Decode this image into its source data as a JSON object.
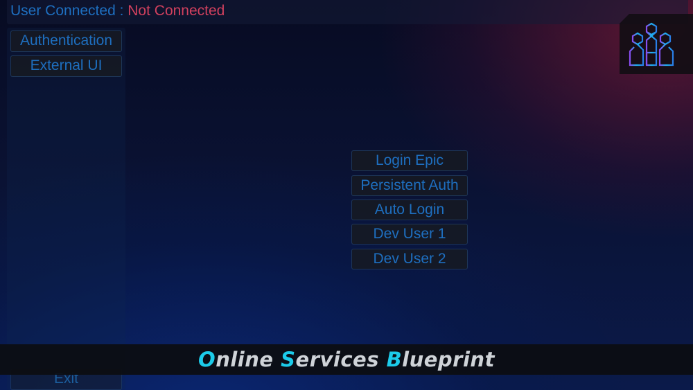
{
  "header": {
    "user_connected_label": "User Connected : ",
    "connection_status": "Not Connected"
  },
  "sidebar": {
    "items": [
      {
        "label": "Authentication"
      },
      {
        "label": "External UI"
      }
    ],
    "exit_label": "Exit"
  },
  "main": {
    "buttons": [
      {
        "label": "Login Epic"
      },
      {
        "label": "Persistent Auth"
      },
      {
        "label": "Auto Login"
      },
      {
        "label": "Dev User 1"
      },
      {
        "label": "Dev User 2"
      }
    ]
  },
  "banner": {
    "words": [
      {
        "initial": "O",
        "rest": "nline "
      },
      {
        "initial": "S",
        "rest": "ervices "
      },
      {
        "initial": "B",
        "rest": "lueprint"
      }
    ]
  },
  "logo": {
    "icon": "team-hexagon-logo"
  },
  "colors": {
    "label_blue": "#1e6fc0",
    "status_red": "#d0405e",
    "banner_accent": "#1ccbea",
    "banner_text": "#cfd3d8"
  }
}
